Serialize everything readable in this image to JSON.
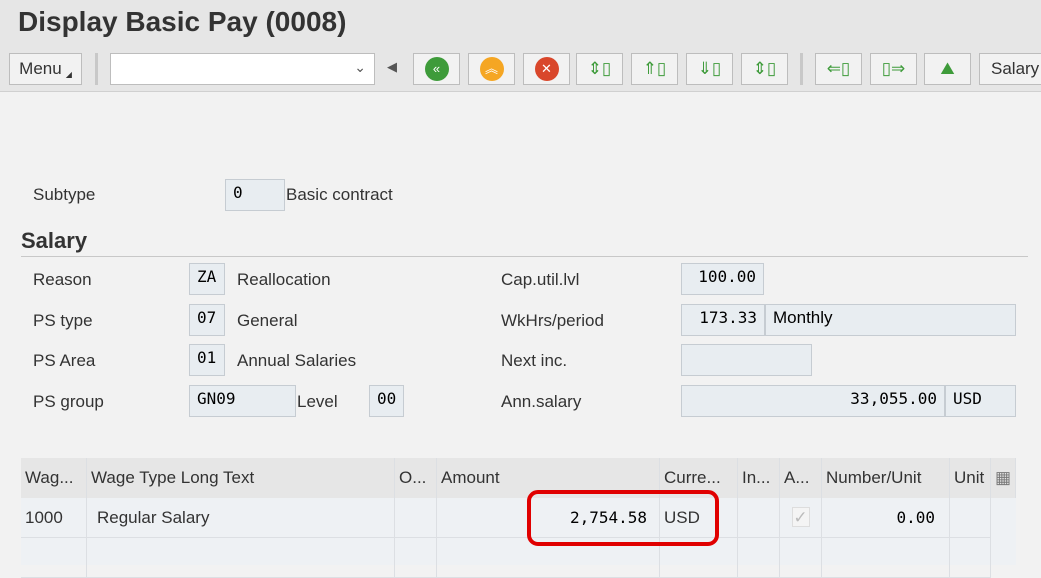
{
  "title": "Display Basic Pay (0008)",
  "toolbar": {
    "menu_label": "Menu",
    "command_value": "",
    "salary_label": "Salary",
    "icons": [
      "first-record-icon",
      "previous-record-icon",
      "delete-icon",
      "overview-icon",
      "prev-page-icon",
      "next-page-icon",
      "all-icon",
      "previous-entry-icon",
      "next-entry-icon",
      "image-icon"
    ]
  },
  "subtype": {
    "label": "Subtype",
    "value": "0",
    "text": "Basic contract"
  },
  "salary": {
    "heading": "Salary",
    "reason": {
      "label": "Reason",
      "value": "ZA",
      "text": "Reallocation"
    },
    "ps_type": {
      "label": "PS type",
      "value": "07",
      "text": "General"
    },
    "ps_area": {
      "label": "PS Area",
      "value": "01",
      "text": "Annual Salaries"
    },
    "ps_group": {
      "label": "PS group",
      "value": "GN09",
      "level_label": "Level",
      "level_value": "00"
    },
    "cap_util": {
      "label": "Cap.util.lvl",
      "value": "100.00"
    },
    "wkhrs": {
      "label": "WkHrs/period",
      "value": "173.33",
      "period": "Monthly"
    },
    "next_inc": {
      "label": "Next inc.",
      "value": ""
    },
    "ann_salary": {
      "label": "Ann.salary",
      "value": "33,055.00",
      "currency": "USD"
    }
  },
  "table": {
    "headers": [
      "Wag...",
      "Wage Type Long Text",
      "O...",
      "Amount",
      "Curre...",
      "In...",
      "A...",
      "Number/Unit",
      "Unit"
    ],
    "rows": [
      {
        "wage_type": "1000",
        "long_text": "Regular Salary",
        "op": "",
        "amount": "2,754.58",
        "currency": "USD",
        "ind": "",
        "assign": true,
        "number": "0.00",
        "unit": ""
      }
    ]
  },
  "colors": {
    "highlight": "#e00000"
  }
}
